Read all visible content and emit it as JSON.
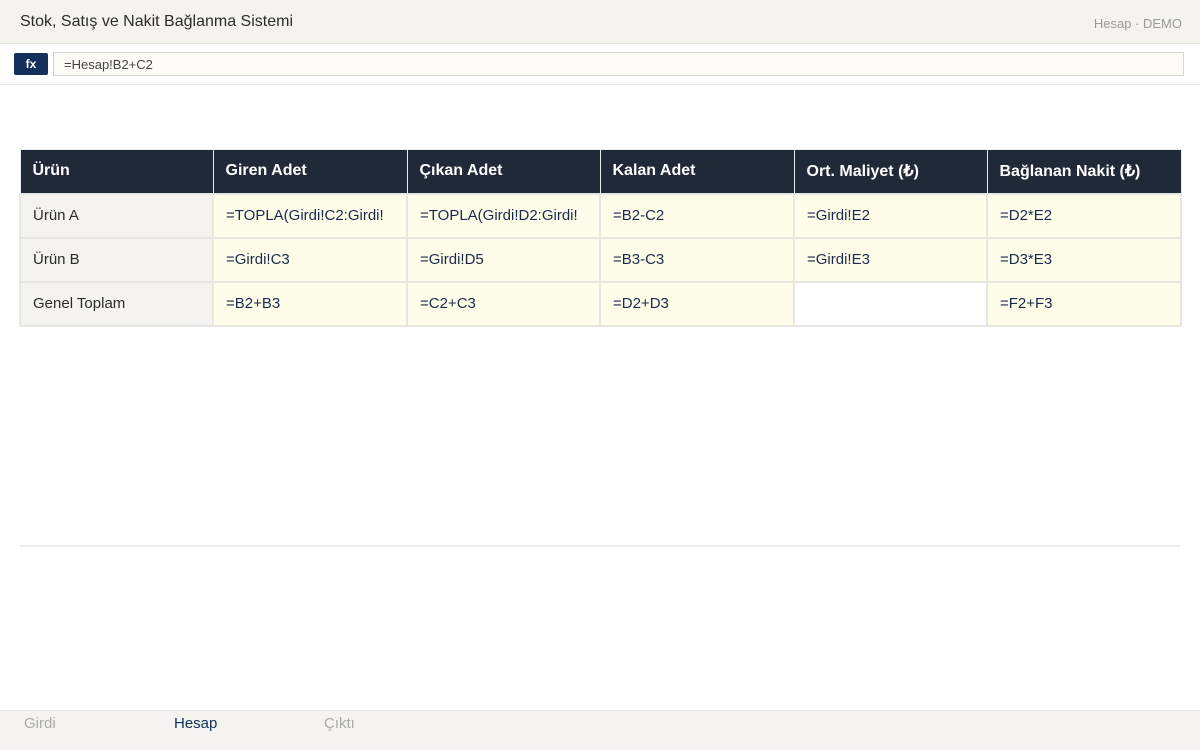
{
  "window": {
    "title": "Stok, Satış ve Nakit Bağlanma Sistemi",
    "sheet_indicator": "Hesap · DEMO"
  },
  "formula_bar": {
    "fx_label": "fx",
    "value": "=Hesap!B2+C2"
  },
  "grid": {
    "headers": [
      "Ürün",
      "Giren Adet",
      "Çıkan Adet",
      "Kalan Adet",
      "Ort. Maliyet (₺)",
      "Bağlanan Nakit (₺)"
    ],
    "rows": [
      {
        "label": "Ürün A",
        "cells": [
          "=TOPLA(Girdi!C2:Girdi!",
          "=TOPLA(Girdi!D2:Girdi!",
          "=B2-C2",
          "=Girdi!E2",
          "=D2*E2"
        ]
      },
      {
        "label": "Ürün B",
        "cells": [
          "=Girdi!C3",
          "=Girdi!D5",
          "=B3-C3",
          "=Girdi!E3",
          "=D3*E3"
        ]
      },
      {
        "label": "Genel Toplam",
        "cells": [
          "=B2+B3",
          "=C2+C3",
          "=D2+D3",
          "",
          "=F2+F3"
        ]
      }
    ]
  },
  "sheet_tabs": [
    {
      "label": "Girdi",
      "active": false
    },
    {
      "label": "Hesap",
      "active": true
    },
    {
      "label": "Çıktı",
      "active": false
    }
  ],
  "colors": {
    "header_bg": "#1f2937",
    "accent": "#12305a",
    "formula_cell_bg": "#fefdea",
    "label_cell_bg": "#f4f3ef"
  }
}
